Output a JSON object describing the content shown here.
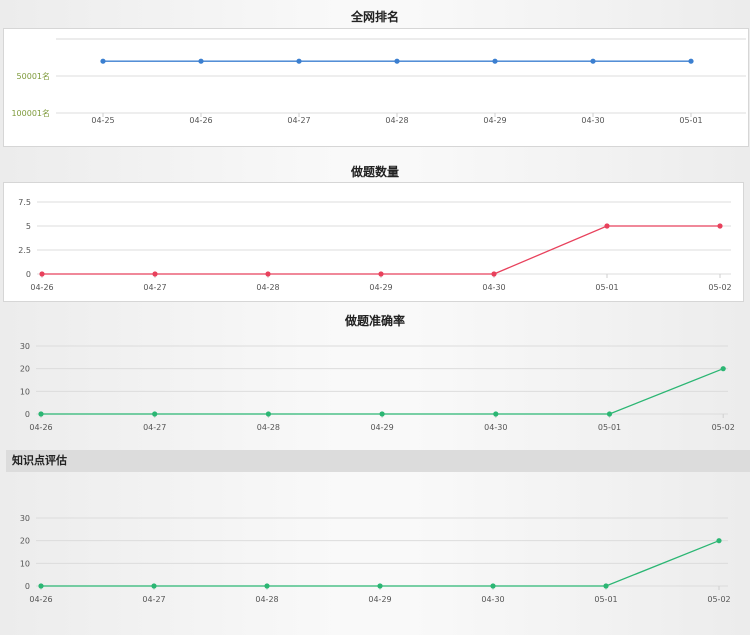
{
  "titles": {
    "rank": "全网排名",
    "count": "做题数量",
    "accuracy": "做题准确率"
  },
  "section": {
    "knowledge_label": "知识点评估"
  },
  "colors": {
    "rank": "#3b7fd0",
    "count": "#e8415c",
    "accuracy": "#2bb673",
    "knowledge": "#2bb673",
    "rank_axis_label": "#7e9a3b"
  },
  "chart_data": [
    {
      "id": "rank",
      "type": "line",
      "title": "全网排名",
      "categories": [
        "04-25",
        "04-26",
        "04-27",
        "04-28",
        "04-29",
        "04-30",
        "05-01"
      ],
      "series": [
        {
          "values": [
            30001,
            30001,
            30001,
            30001,
            30001,
            30001,
            30001
          ]
        }
      ],
      "yticks": [
        "50001名",
        "100001名"
      ],
      "ylim": [
        0,
        100001
      ],
      "inverted": true,
      "grid": true
    },
    {
      "id": "count",
      "type": "line",
      "title": "做题数量",
      "categories": [
        "04-26",
        "04-27",
        "04-28",
        "04-29",
        "04-30",
        "05-01",
        "05-02"
      ],
      "series": [
        {
          "values": [
            0,
            0,
            0,
            0,
            0,
            5,
            5
          ]
        }
      ],
      "yticks": [
        "0",
        "2.5",
        "5",
        "7.5"
      ],
      "ylim": [
        0,
        7.5
      ],
      "grid": true
    },
    {
      "id": "accuracy",
      "type": "line",
      "title": "做题准确率",
      "categories": [
        "04-26",
        "04-27",
        "04-28",
        "04-29",
        "04-30",
        "05-01",
        "05-02"
      ],
      "series": [
        {
          "values": [
            0,
            0,
            0,
            0,
            0,
            0,
            20
          ]
        }
      ],
      "yticks": [
        "0",
        "10",
        "20",
        "30"
      ],
      "ylim": [
        0,
        30
      ],
      "grid": true
    },
    {
      "id": "knowledge",
      "type": "line",
      "categories": [
        "04-26",
        "04-27",
        "04-28",
        "04-29",
        "04-30",
        "05-01",
        "05-02"
      ],
      "series": [
        {
          "values": [
            0,
            0,
            0,
            0,
            0,
            0,
            20
          ]
        }
      ],
      "yticks": [
        "0",
        "10",
        "20",
        "30"
      ],
      "ylim": [
        0,
        30
      ],
      "grid": true
    }
  ]
}
